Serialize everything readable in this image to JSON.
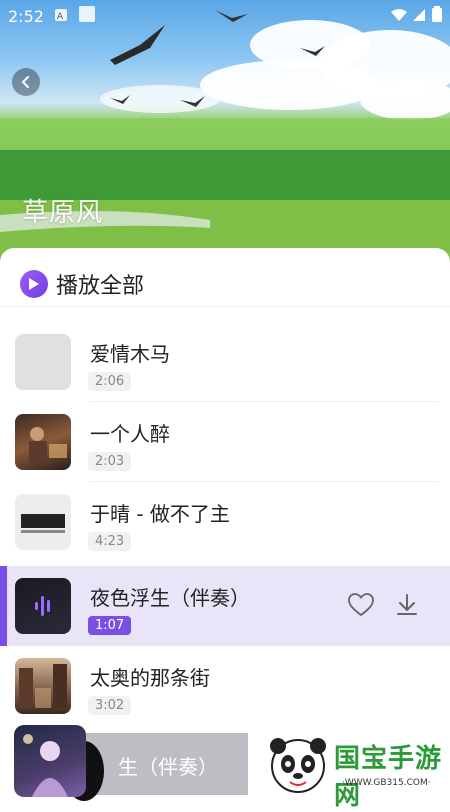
{
  "status_bar": {
    "time": "2:52"
  },
  "hero": {
    "title": "草原风"
  },
  "play_all": {
    "label": "播放全部"
  },
  "songs": [
    {
      "title": "爱情木马",
      "duration": "2:06"
    },
    {
      "title": "一个人醉",
      "duration": "2:03"
    },
    {
      "title": "于晴 - 做不了主",
      "duration": "4:23"
    },
    {
      "title": "夜色浮生（伴奏）",
      "duration": "1:07",
      "active": true
    },
    {
      "title": "太奥的那条街",
      "duration": "3:02"
    }
  ],
  "mini_player": {
    "title": "生（伴奏）"
  },
  "watermark": {
    "brand": "国宝手游网",
    "url": "·WWW.GB315.COM·"
  },
  "colors": {
    "accent": "#7a4fe6",
    "active_row": "#e9e4f8"
  }
}
